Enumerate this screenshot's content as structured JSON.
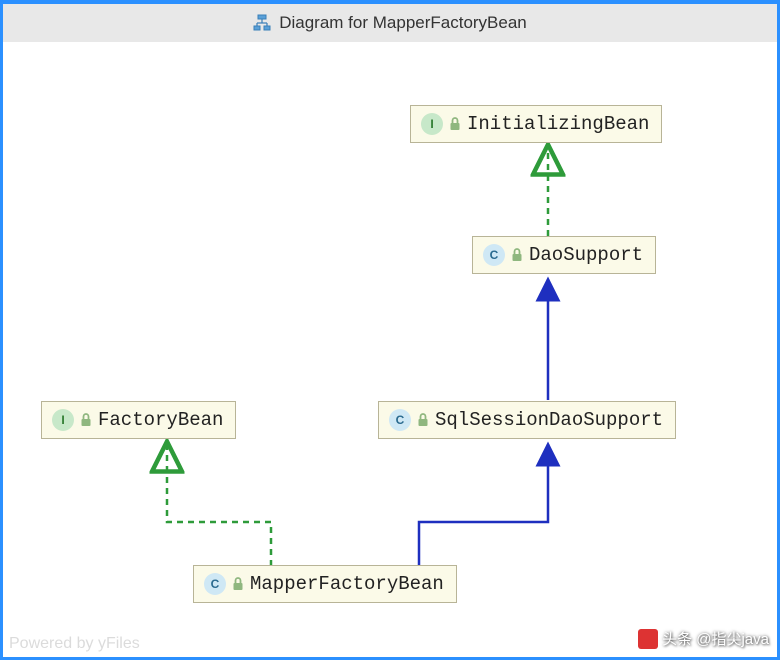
{
  "title": "Diagram for MapperFactoryBean",
  "watermark": "Powered by yFiles",
  "credit": "头条 @指尖java",
  "nodes": {
    "initializingBean": {
      "label": "InitializingBean",
      "kind": "I"
    },
    "daoSupport": {
      "label": "DaoSupport",
      "kind": "C"
    },
    "factoryBean": {
      "label": "FactoryBean",
      "kind": "I"
    },
    "sqlSessionDaoSupport": {
      "label": "SqlSessionDaoSupport",
      "kind": "C"
    },
    "mapperFactoryBean": {
      "label": "MapperFactoryBean",
      "kind": "C"
    }
  },
  "edges": [
    {
      "from": "daoSupport",
      "to": "initializingBean",
      "type": "implements"
    },
    {
      "from": "sqlSessionDaoSupport",
      "to": "daoSupport",
      "type": "extends"
    },
    {
      "from": "mapperFactoryBean",
      "to": "sqlSessionDaoSupport",
      "type": "extends"
    },
    {
      "from": "mapperFactoryBean",
      "to": "factoryBean",
      "type": "implements"
    }
  ],
  "colors": {
    "extends": "#1e2fbf",
    "implements": "#2e9b3a",
    "nodeBg": "#fbfae8",
    "nodeBorder": "#b8b497"
  },
  "chart_data": {
    "type": "diagram",
    "title": "Diagram for MapperFactoryBean",
    "nodes": [
      {
        "id": "InitializingBean",
        "kind": "interface"
      },
      {
        "id": "DaoSupport",
        "kind": "class"
      },
      {
        "id": "FactoryBean",
        "kind": "interface"
      },
      {
        "id": "SqlSessionDaoSupport",
        "kind": "class"
      },
      {
        "id": "MapperFactoryBean",
        "kind": "class"
      }
    ],
    "edges": [
      {
        "from": "DaoSupport",
        "to": "InitializingBean",
        "relation": "implements"
      },
      {
        "from": "SqlSessionDaoSupport",
        "to": "DaoSupport",
        "relation": "extends"
      },
      {
        "from": "MapperFactoryBean",
        "to": "SqlSessionDaoSupport",
        "relation": "extends"
      },
      {
        "from": "MapperFactoryBean",
        "to": "FactoryBean",
        "relation": "implements"
      }
    ]
  }
}
